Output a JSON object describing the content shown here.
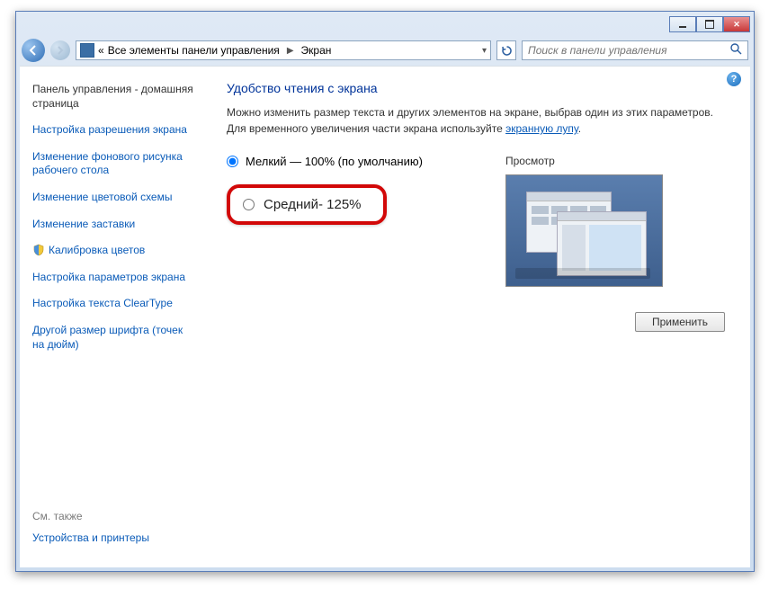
{
  "window_controls": {
    "min": "minimize",
    "max": "maximize",
    "close": "close"
  },
  "address": {
    "prefix": "«",
    "root": "Все элементы панели управления",
    "current": "Экран"
  },
  "search": {
    "placeholder": "Поиск в панели управления"
  },
  "sidebar": {
    "home": "Панель управления - домашняя страница",
    "links": [
      "Настройка разрешения экрана",
      "Изменение фонового рисунка рабочего стола",
      "Изменение цветовой схемы",
      "Изменение заставки",
      "Калибровка цветов",
      "Настройка параметров экрана",
      "Настройка текста ClearType",
      "Другой размер шрифта (точек на дюйм)"
    ],
    "see_also": "См. также",
    "footer_link": "Устройства и принтеры"
  },
  "main": {
    "heading": "Удобство чтения с экрана",
    "desc_part1": "Можно изменить размер текста и других элементов на экране, выбрав один из этих параметров. Для временного увеличения части экрана используйте ",
    "desc_link": "экранную лупу",
    "desc_part2": ".",
    "option_small": "Мелкий — 100% (по умолчанию)",
    "option_medium": "Средний- 125%",
    "preview_label": "Просмотр",
    "apply": "Применить"
  }
}
